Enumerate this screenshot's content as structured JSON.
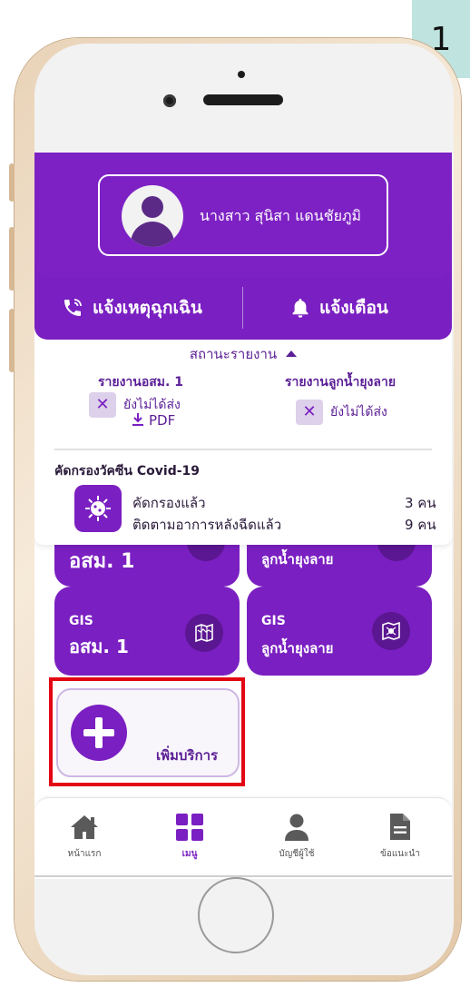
{
  "step_badge": "1",
  "profile": {
    "name": "นางสาว สุนิสา แดนชัยภูมิ",
    "avatar_icon": "user-avatar-icon"
  },
  "actions": {
    "emergency_label": "แจ้งเหตุฉุกเฉิน",
    "emergency_icon": "phone-call-icon",
    "alert_label": "แจ้งเตือน",
    "alert_icon": "bell-icon"
  },
  "status": {
    "title": "สถานะรายงาน",
    "report_osm": {
      "title": "รายงานอสม. 1",
      "state": "ยังไม่ได้ส่ง",
      "pdf_label": "PDF"
    },
    "report_larvae": {
      "title": "รายงานลูกน้ำยุงลาย",
      "state": "ยังไม่ได้ส่ง"
    },
    "covid": {
      "title": "คัดกรองวัคซีน Covid-19",
      "screened_label": "คัดกรองแล้ว",
      "screened_value": "3 คน",
      "followed_label": "ติดตามอาการหลังฉีดแล้ว",
      "followed_value": "9 คน"
    }
  },
  "tiles": {
    "top1_label": "อสม. 1",
    "top2_label": "ลูกน้ำยุงลาย",
    "gis1_small": "GIS",
    "gis1_large": "อสม. 1",
    "gis2_small": "GIS",
    "gis2_large": "ลูกน้ำยุงลาย",
    "add_label": "เพิ่มบริการ"
  },
  "nav": {
    "home": "หน้าแรก",
    "menu": "เมนู",
    "account": "บัญชีผู้ใช้",
    "advice": "ข้อแนะนำ"
  },
  "colors": {
    "primary": "#7a1fc1",
    "dark_purple": "#5b1691",
    "highlight": "#e30613",
    "badge": "#bfe3df"
  }
}
